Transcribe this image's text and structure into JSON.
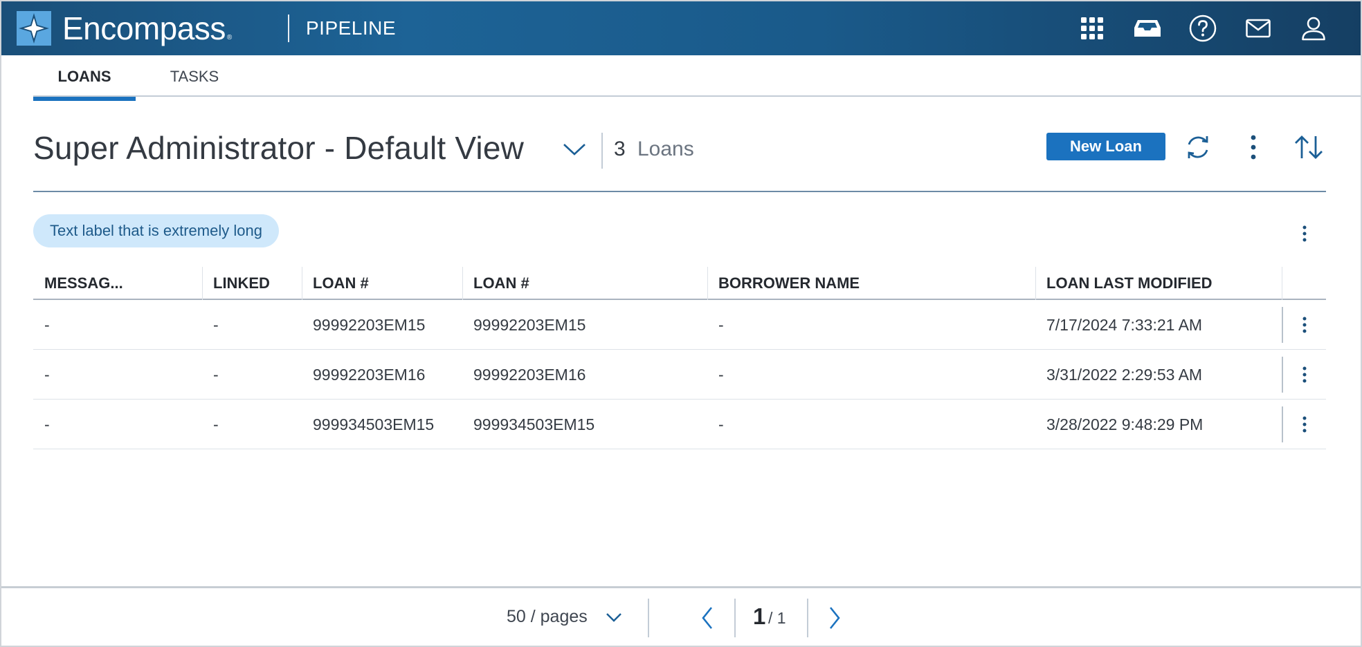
{
  "header": {
    "brand": "Encompass",
    "trademark": "®",
    "app_name": "PIPELINE",
    "icons": [
      "apps-grid-icon",
      "inbox-tray-icon",
      "help-icon",
      "mail-icon",
      "user-icon"
    ]
  },
  "tabs": [
    {
      "label": "LOANS",
      "active": true
    },
    {
      "label": "TASKS",
      "active": false
    }
  ],
  "view": {
    "title": "Super Administrator - Default View",
    "count": "3",
    "count_label": "Loans",
    "new_loan_label": "New Loan"
  },
  "filter_chip": {
    "label": "Text label that is extremely long"
  },
  "table": {
    "columns": [
      "MESSAG...",
      "LINKED",
      "LOAN #",
      "LOAN #",
      "BORROWER NAME",
      "LOAN LAST MODIFIED"
    ],
    "rows": [
      [
        "-",
        "-",
        "99992203EM15",
        "99992203EM15",
        "-",
        "7/17/2024 7:33:21 AM"
      ],
      [
        "-",
        "-",
        "99992203EM16",
        "99992203EM16",
        "-",
        "3/31/2022 2:29:53 AM"
      ],
      [
        "-",
        "-",
        "999934503EM15",
        "999934503EM15",
        "-",
        "3/28/2022 9:48:29 PM"
      ]
    ]
  },
  "pagination": {
    "per_page": "50 / pages",
    "current_page": "1",
    "total_pages": "/ 1"
  },
  "colors": {
    "accent": "#1b72bf",
    "header_bg": "#1d6396",
    "chip_bg": "#cfe8fb",
    "chip_text": "#1e5a8a"
  }
}
